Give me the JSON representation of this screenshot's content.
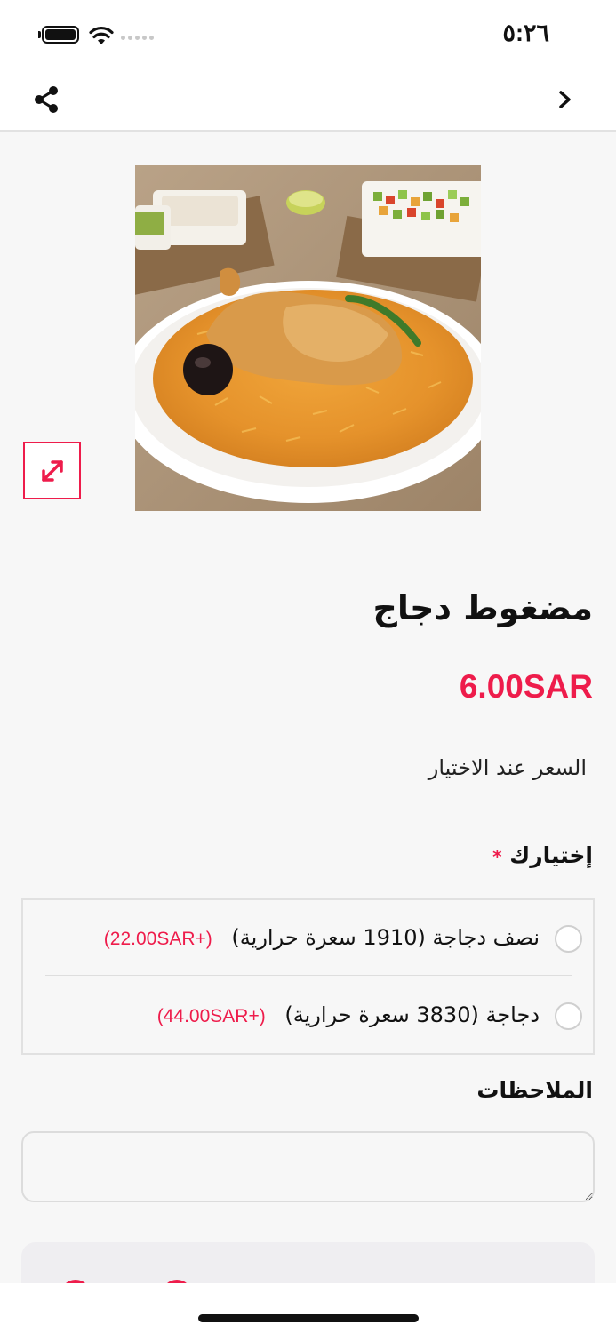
{
  "status_bar": {
    "time": "٥:٢٦"
  },
  "nav": {
    "share_icon": "share-icon",
    "back_icon": "chevron-right-icon"
  },
  "dish": {
    "name": "مضغوط دجاج",
    "price": "6.00SAR",
    "price_note": "السعر عند الاختيار",
    "image_icon": "expand-icon"
  },
  "choice": {
    "label": "إختيارك",
    "required_mark": "*",
    "options": [
      {
        "label": "نصف دجاجة (1910 سعرة حرارية)",
        "price": "(+22.00SAR)"
      },
      {
        "label": "دجاجة (3830 سعرة حرارية)",
        "price": "(+44.00SAR)"
      }
    ]
  },
  "notes": {
    "label": "الملاحظات",
    "placeholder": ""
  },
  "colors": {
    "accent": "#ee1c4b",
    "background": "#f7f7f7"
  }
}
